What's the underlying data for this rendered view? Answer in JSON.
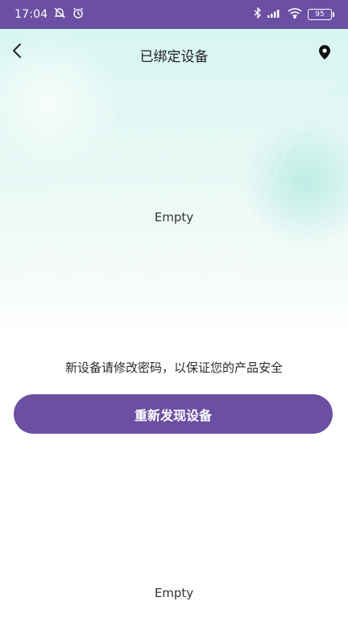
{
  "status_bar": {
    "time": "17:04",
    "battery": "95",
    "icons": [
      "alarm-off-icon",
      "alarm-icon",
      "bluetooth-icon",
      "signal-icon",
      "wifi-icon",
      "battery-icon"
    ]
  },
  "nav": {
    "title": "已绑定设备",
    "back_icon": "chevron-left-icon",
    "right_icon": "location-pin-icon"
  },
  "main": {
    "empty_top": "Empty",
    "notice": "新设备请修改密码，以保证您的产品安全",
    "rediscover_button": "重新发现设备",
    "empty_bottom": "Empty"
  },
  "colors": {
    "accent": "#6b4fa2",
    "hero_bg": "#d7f6f1",
    "text": "#2b2b2b"
  }
}
